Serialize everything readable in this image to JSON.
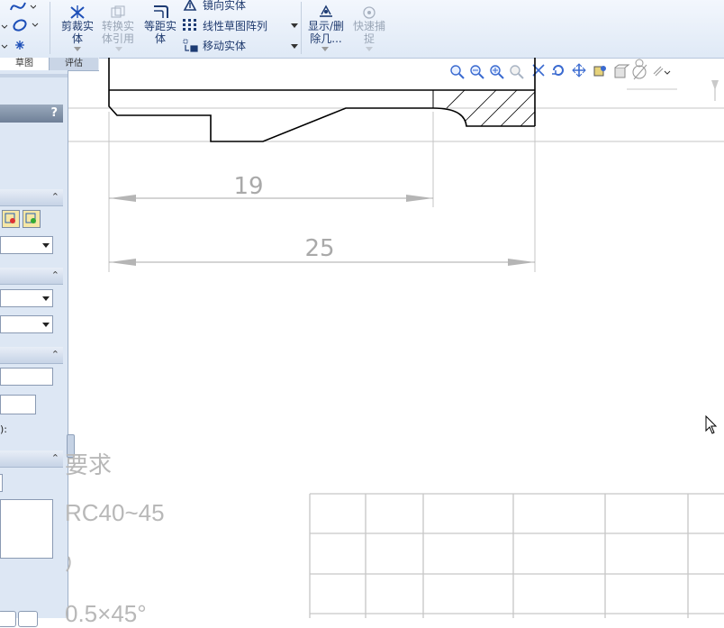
{
  "ribbon": {
    "trim_label_line1": "剪裁实",
    "trim_label_line2": "体",
    "convert_label_line1": "转换实",
    "convert_label_line2": "体引用",
    "offset_label_line1": "等距实",
    "offset_label_line2": "体",
    "mirror_label": "镜向实体",
    "linear_pattern_label": "线性草图阵列",
    "move_label": "移动实体",
    "show_delete_line1": "显示/删",
    "show_delete_line2": "除几...",
    "quick_snap_line1": "快速捕",
    "quick_snap_line2": "捉"
  },
  "tabs": {
    "sketch": "草图",
    "evaluate": "评估"
  },
  "panel": {
    "help_glyph": "?",
    "label_partial": "):"
  },
  "drawing": {
    "dim_inner": "19",
    "dim_outer": "25",
    "note_title_partial": "要求",
    "note_hardness_partial": "RC40~45",
    "note_chamfer_partial": "0.5×45°"
  },
  "colors": {
    "ribbon_text": "#1f3a6e",
    "panel_bg": "#dde7f4",
    "dimension": "#aaaaaa"
  }
}
